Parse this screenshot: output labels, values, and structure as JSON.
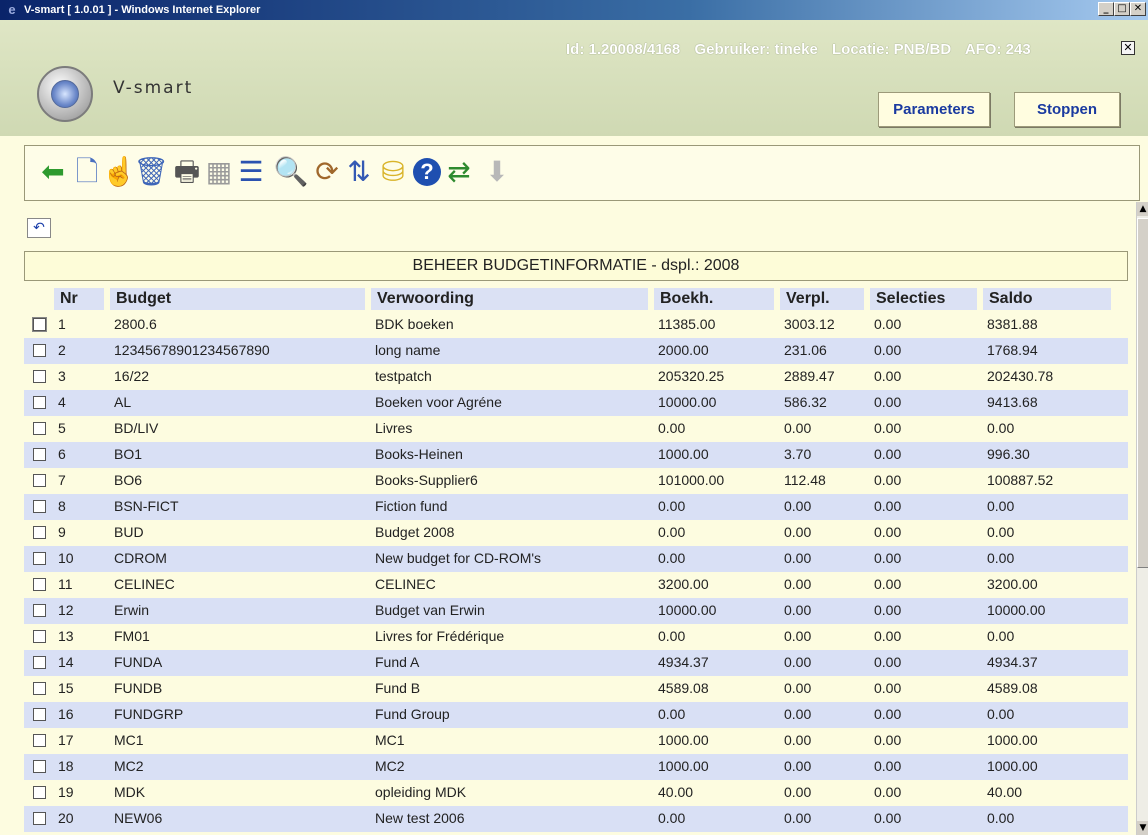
{
  "window": {
    "title": "V-smart [ 1.0.01 ] - Windows Internet Explorer",
    "min": "_",
    "max": "□",
    "close": "✕"
  },
  "app": {
    "brand": "V-smart",
    "session": {
      "id": "Id: 1.20008/4168",
      "user": "Gebruiker: tineke",
      "location": "Locatie: PNB/BD",
      "afo": "AFO: 243"
    },
    "parameters_label": "Parameters",
    "stop_label": "Stoppen"
  },
  "toolbar": {
    "icons": [
      {
        "name": "back-arrow-icon",
        "glyph": "⬅",
        "color": "#2e9a2e"
      },
      {
        "name": "new-document-icon",
        "glyph": "🗋",
        "color": "#4a70c0"
      },
      {
        "name": "select-hand-icon",
        "glyph": "☝",
        "color": "#555555"
      },
      {
        "name": "delete-trash-icon",
        "glyph": "🗑",
        "color": "#3e66b8"
      },
      {
        "name": "print-icon",
        "glyph": "🖶",
        "color": "#555555"
      },
      {
        "name": "afo-icon",
        "glyph": "▦",
        "color": "#9a9a9a"
      },
      {
        "name": "list-icon",
        "glyph": "☰",
        "color": "#2b52b0"
      },
      {
        "name": "search-users-icon",
        "glyph": "🔍",
        "color": "#a0682c"
      },
      {
        "name": "refresh-users-icon",
        "glyph": "⟳",
        "color": "#a0682c"
      },
      {
        "name": "sort-numbers-icon",
        "glyph": "⇅",
        "color": "#3459b4"
      },
      {
        "name": "database-import-icon",
        "glyph": "⛁",
        "color": "#d9b42a"
      },
      {
        "name": "help-icon",
        "glyph": "?",
        "color": "#ffffff"
      },
      {
        "name": "user-sync-icon",
        "glyph": "⇄",
        "color": "#2e8a2e"
      },
      {
        "name": "down-arrow-icon",
        "glyph": "⬇",
        "color": "#b8b8b8"
      }
    ]
  },
  "content": {
    "undo_icon": "↶",
    "panel_title": "BEHEER BUDGETINFORMATIE - dspl.: 2008",
    "columns": [
      "Nr",
      "Budget",
      "Verwoording",
      "Boekh.",
      "Verpl.",
      "Selecties",
      "Saldo"
    ],
    "rows": [
      [
        "1",
        "2800.6",
        "BDK boeken",
        "11385.00",
        "3003.12",
        "0.00",
        "8381.88"
      ],
      [
        "2",
        "12345678901234567890",
        "long name",
        "2000.00",
        "231.06",
        "0.00",
        "1768.94"
      ],
      [
        "3",
        "16/22",
        "testpatch",
        "205320.25",
        "2889.47",
        "0.00",
        "202430.78"
      ],
      [
        "4",
        "AL",
        "Boeken voor Agréne",
        "10000.00",
        "586.32",
        "0.00",
        "9413.68"
      ],
      [
        "5",
        "BD/LIV",
        "Livres",
        "0.00",
        "0.00",
        "0.00",
        "0.00"
      ],
      [
        "6",
        "BO1",
        "Books-Heinen",
        "1000.00",
        "3.70",
        "0.00",
        "996.30"
      ],
      [
        "7",
        "BO6",
        "Books-Supplier6",
        "101000.00",
        "112.48",
        "0.00",
        "100887.52"
      ],
      [
        "8",
        "BSN-FICT",
        "Fiction fund",
        "0.00",
        "0.00",
        "0.00",
        "0.00"
      ],
      [
        "9",
        "BUD",
        "Budget 2008",
        "0.00",
        "0.00",
        "0.00",
        "0.00"
      ],
      [
        "10",
        "CDROM",
        "New budget for CD-ROM's",
        "0.00",
        "0.00",
        "0.00",
        "0.00"
      ],
      [
        "11",
        "CELINEC",
        "CELINEC",
        "3200.00",
        "0.00",
        "0.00",
        "3200.00"
      ],
      [
        "12",
        "Erwin",
        "Budget van Erwin",
        "10000.00",
        "0.00",
        "0.00",
        "10000.00"
      ],
      [
        "13",
        "FM01",
        "Livres for Frédérique",
        "0.00",
        "0.00",
        "0.00",
        "0.00"
      ],
      [
        "14",
        "FUNDA",
        "Fund A",
        "4934.37",
        "0.00",
        "0.00",
        "4934.37"
      ],
      [
        "15",
        "FUNDB",
        "Fund B",
        "4589.08",
        "0.00",
        "0.00",
        "4589.08"
      ],
      [
        "16",
        "FUNDGRP",
        "Fund Group",
        "0.00",
        "0.00",
        "0.00",
        "0.00"
      ],
      [
        "17",
        "MC1",
        "MC1",
        "1000.00",
        "0.00",
        "0.00",
        "1000.00"
      ],
      [
        "18",
        "MC2",
        "MC2",
        "1000.00",
        "0.00",
        "0.00",
        "1000.00"
      ],
      [
        "19",
        "MDK",
        "opleiding MDK",
        "40.00",
        "0.00",
        "0.00",
        "40.00"
      ],
      [
        "20",
        "NEW06",
        "New test 2006",
        "0.00",
        "0.00",
        "0.00",
        "0.00"
      ]
    ]
  },
  "scrollbar": {
    "up": "▲",
    "down": "▼"
  }
}
